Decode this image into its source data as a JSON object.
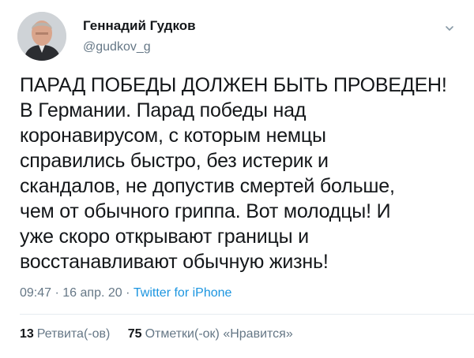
{
  "author": {
    "display_name": "Геннадий Гудков",
    "handle": "@gudkov_g"
  },
  "tweet": {
    "text": "ПАРАД ПОБЕДЫ ДОЛЖЕН БЫТЬ ПРОВЕДЕН!\nВ Германии. Парад победы над\nкоронавирусом, с которым немцы\nсправились быстро, без истерик и\nскандалов, не допустив смертей больше,\nчем от обычного гриппа. Вот молодцы! И\nуже скоро открывают границы и\nвосстанавливают обычную  жизнь!"
  },
  "meta": {
    "time": "09:47",
    "separator": "·",
    "date": "16 апр. 20",
    "source": "Twitter for iPhone"
  },
  "stats": {
    "retweets_count": "13",
    "retweets_label": "Ретвита(-ов)",
    "likes_count": "75",
    "likes_label": "Отметки(-ок) «Нравится»"
  },
  "icons": {
    "menu": "chevron-down-icon"
  },
  "colors": {
    "text": "#14171a",
    "secondary": "#657786",
    "link": "#1b95e0",
    "divider": "#e6ecf0"
  }
}
